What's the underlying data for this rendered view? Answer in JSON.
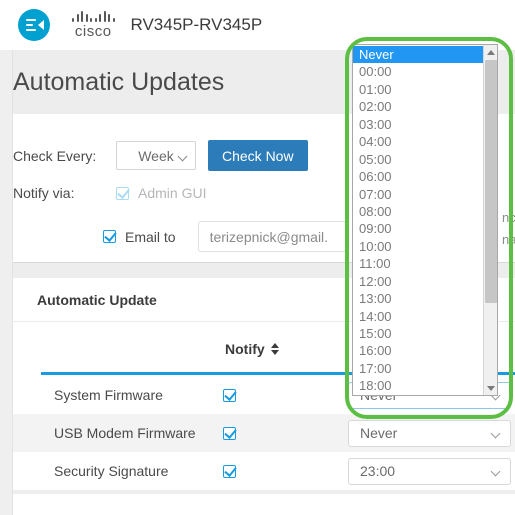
{
  "header": {
    "logo_icon": "collapse-menu-icon",
    "brand": "cisco",
    "device_name": "RV345P-RV345P"
  },
  "page": {
    "title": "Automatic Updates"
  },
  "settings": {
    "check_every_label": "Check Every:",
    "check_every_value": "Week",
    "check_now_label": "Check Now",
    "notify_via_label": "Notify via:",
    "admin_gui_label": "Admin GUI",
    "admin_gui_checked": true,
    "email_to_label": "Email to",
    "email_to_checked": true,
    "email_value": "terizepnick@gmail."
  },
  "edge_fragments": {
    "frag_top": "nc",
    "frag_bottom": "na"
  },
  "table": {
    "card_title": "Automatic Update",
    "columns": {
      "notify": "Notify"
    },
    "rows": [
      {
        "name": "System Firmware",
        "notify_checked": true,
        "schedule": "Never"
      },
      {
        "name": "USB Modem Firmware",
        "notify_checked": true,
        "schedule": "Never"
      },
      {
        "name": "Security Signature",
        "notify_checked": true,
        "schedule": "23:00"
      }
    ]
  },
  "dropdown": {
    "selected": "Never",
    "options": [
      "Never",
      "00:00",
      "01:00",
      "02:00",
      "03:00",
      "04:00",
      "05:00",
      "06:00",
      "07:00",
      "08:00",
      "09:00",
      "10:00",
      "11:00",
      "12:00",
      "13:00",
      "14:00",
      "15:00",
      "16:00",
      "17:00",
      "18:00"
    ]
  },
  "colors": {
    "brand_blue": "#00a0d1",
    "button_blue": "#2b7cb8",
    "selection_blue": "#2196f3",
    "accent_rule": "#1a9ae0",
    "highlight_green": "#5cbf43"
  }
}
